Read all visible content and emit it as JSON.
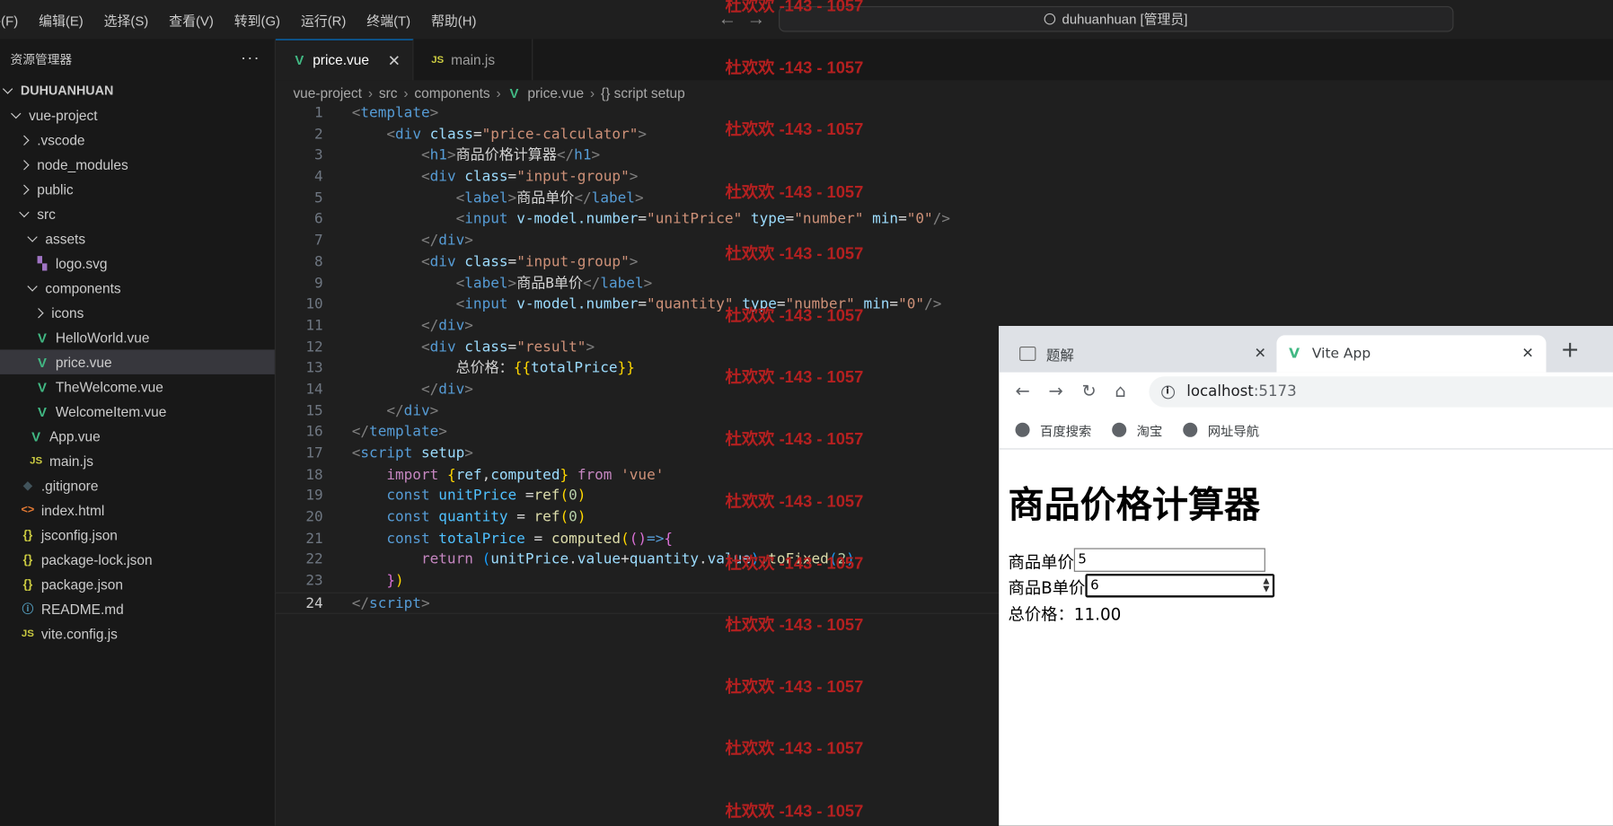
{
  "menu": [
    "件(F)",
    "编辑(E)",
    "选择(S)",
    "查看(V)",
    "转到(G)",
    "运行(R)",
    "终端(T)",
    "帮助(H)"
  ],
  "command_center": "duhuanhuan [管理员]",
  "sidebar": {
    "title": "资源管理器",
    "root": "DUHUANHUAN",
    "items": [
      {
        "label": "vue-project",
        "depth": 0,
        "chev": "down",
        "icon": ""
      },
      {
        "label": ".vscode",
        "depth": 1,
        "chev": "right",
        "icon": ""
      },
      {
        "label": "node_modules",
        "depth": 1,
        "chev": "right",
        "icon": ""
      },
      {
        "label": "public",
        "depth": 1,
        "chev": "right",
        "icon": ""
      },
      {
        "label": "src",
        "depth": 1,
        "chev": "down",
        "icon": ""
      },
      {
        "label": "assets",
        "depth": 2,
        "chev": "down",
        "icon": ""
      },
      {
        "label": "logo.svg",
        "depth": 3,
        "chev": "",
        "icon": "svg"
      },
      {
        "label": "components",
        "depth": 2,
        "chev": "down",
        "icon": ""
      },
      {
        "label": "icons",
        "depth": 3,
        "chev": "right",
        "icon": ""
      },
      {
        "label": "HelloWorld.vue",
        "depth": 3,
        "chev": "",
        "icon": "vue"
      },
      {
        "label": "price.vue",
        "depth": 3,
        "chev": "",
        "icon": "vue",
        "selected": true
      },
      {
        "label": "TheWelcome.vue",
        "depth": 3,
        "chev": "",
        "icon": "vue"
      },
      {
        "label": "WelcomeItem.vue",
        "depth": 3,
        "chev": "",
        "icon": "vue"
      },
      {
        "label": "App.vue",
        "depth": 2,
        "chev": "",
        "icon": "vue"
      },
      {
        "label": "main.js",
        "depth": 2,
        "chev": "",
        "icon": "js"
      },
      {
        "label": ".gitignore",
        "depth": 1,
        "chev": "",
        "icon": "git"
      },
      {
        "label": "index.html",
        "depth": 1,
        "chev": "",
        "icon": "html"
      },
      {
        "label": "jsconfig.json",
        "depth": 1,
        "chev": "",
        "icon": "json"
      },
      {
        "label": "package-lock.json",
        "depth": 1,
        "chev": "",
        "icon": "json"
      },
      {
        "label": "package.json",
        "depth": 1,
        "chev": "",
        "icon": "json"
      },
      {
        "label": "README.md",
        "depth": 1,
        "chev": "",
        "icon": "info"
      },
      {
        "label": "vite.config.js",
        "depth": 1,
        "chev": "",
        "icon": "js"
      }
    ]
  },
  "tabs": [
    {
      "label": "price.vue",
      "icon": "vue",
      "active": true
    },
    {
      "label": "main.js",
      "icon": "js",
      "active": false
    }
  ],
  "breadcrumb": [
    "vue-project",
    "src",
    "components",
    "price.vue",
    "{} script setup"
  ],
  "code_lines": [
    [
      [
        "t-br",
        "<"
      ],
      [
        "t-tag",
        "template"
      ],
      [
        "t-br",
        ">"
      ]
    ],
    [
      [
        "t-txt",
        "    "
      ],
      [
        "t-br",
        "<"
      ],
      [
        "t-tag",
        "div"
      ],
      [
        "t-txt",
        " "
      ],
      [
        "t-attr",
        "class"
      ],
      [
        "t-txt",
        "="
      ],
      [
        "t-str",
        "\"price-calculator\""
      ],
      [
        "t-br",
        ">"
      ]
    ],
    [
      [
        "t-txt",
        "        "
      ],
      [
        "t-br",
        "<"
      ],
      [
        "t-tag",
        "h1"
      ],
      [
        "t-br",
        ">"
      ],
      [
        "t-txt",
        "商品价格计算器"
      ],
      [
        "t-br",
        "</"
      ],
      [
        "t-tag",
        "h1"
      ],
      [
        "t-br",
        ">"
      ]
    ],
    [
      [
        "t-txt",
        "        "
      ],
      [
        "t-br",
        "<"
      ],
      [
        "t-tag",
        "div"
      ],
      [
        "t-txt",
        " "
      ],
      [
        "t-attr",
        "class"
      ],
      [
        "t-txt",
        "="
      ],
      [
        "t-str",
        "\"input-group\""
      ],
      [
        "t-br",
        ">"
      ]
    ],
    [
      [
        "t-txt",
        "            "
      ],
      [
        "t-br",
        "<"
      ],
      [
        "t-tag",
        "label"
      ],
      [
        "t-br",
        ">"
      ],
      [
        "t-txt",
        "商品单价"
      ],
      [
        "t-br",
        "</"
      ],
      [
        "t-tag",
        "label"
      ],
      [
        "t-br",
        ">"
      ]
    ],
    [
      [
        "t-txt",
        "            "
      ],
      [
        "t-br",
        "<"
      ],
      [
        "t-tag",
        "input"
      ],
      [
        "t-txt",
        " "
      ],
      [
        "t-attr",
        "v-model.number"
      ],
      [
        "t-txt",
        "="
      ],
      [
        "t-str",
        "\"unitPrice\""
      ],
      [
        "t-txt",
        " "
      ],
      [
        "t-attr",
        "type"
      ],
      [
        "t-txt",
        "="
      ],
      [
        "t-str",
        "\"number\""
      ],
      [
        "t-txt",
        " "
      ],
      [
        "t-attr",
        "min"
      ],
      [
        "t-txt",
        "="
      ],
      [
        "t-str",
        "\"0\""
      ],
      [
        "t-br",
        "/>"
      ]
    ],
    [
      [
        "t-txt",
        "        "
      ],
      [
        "t-br",
        "</"
      ],
      [
        "t-tag",
        "div"
      ],
      [
        "t-br",
        ">"
      ]
    ],
    [
      [
        "t-txt",
        "        "
      ],
      [
        "t-br",
        "<"
      ],
      [
        "t-tag",
        "div"
      ],
      [
        "t-txt",
        " "
      ],
      [
        "t-attr",
        "class"
      ],
      [
        "t-txt",
        "="
      ],
      [
        "t-str",
        "\"input-group\""
      ],
      [
        "t-br",
        ">"
      ]
    ],
    [
      [
        "t-txt",
        "            "
      ],
      [
        "t-br",
        "<"
      ],
      [
        "t-tag",
        "label"
      ],
      [
        "t-br",
        ">"
      ],
      [
        "t-txt",
        "商品B单价"
      ],
      [
        "t-br",
        "</"
      ],
      [
        "t-tag",
        "label"
      ],
      [
        "t-br",
        ">"
      ]
    ],
    [
      [
        "t-txt",
        "            "
      ],
      [
        "t-br",
        "<"
      ],
      [
        "t-tag",
        "input"
      ],
      [
        "t-txt",
        " "
      ],
      [
        "t-attr",
        "v-model.number"
      ],
      [
        "t-txt",
        "="
      ],
      [
        "t-str",
        "\"quantity\""
      ],
      [
        "t-txt",
        " "
      ],
      [
        "t-attr",
        "type"
      ],
      [
        "t-txt",
        "="
      ],
      [
        "t-str",
        "\"number\""
      ],
      [
        "t-txt",
        " "
      ],
      [
        "t-attr",
        "min"
      ],
      [
        "t-txt",
        "="
      ],
      [
        "t-str",
        "\"0\""
      ],
      [
        "t-br",
        "/>"
      ]
    ],
    [
      [
        "t-txt",
        "        "
      ],
      [
        "t-br",
        "</"
      ],
      [
        "t-tag",
        "div"
      ],
      [
        "t-br",
        ">"
      ]
    ],
    [
      [
        "t-txt",
        "        "
      ],
      [
        "t-br",
        "<"
      ],
      [
        "t-tag",
        "div"
      ],
      [
        "t-txt",
        " "
      ],
      [
        "t-attr",
        "class"
      ],
      [
        "t-txt",
        "="
      ],
      [
        "t-str",
        "\"result\""
      ],
      [
        "t-br",
        ">"
      ]
    ],
    [
      [
        "t-txt",
        "            总价格："
      ],
      [
        "t-p1",
        "{{"
      ],
      [
        "t-attr",
        "totalPrice"
      ],
      [
        "t-p1",
        "}}"
      ]
    ],
    [
      [
        "t-txt",
        "        "
      ],
      [
        "t-br",
        "</"
      ],
      [
        "t-tag",
        "div"
      ],
      [
        "t-br",
        ">"
      ]
    ],
    [
      [
        "t-txt",
        "    "
      ],
      [
        "t-br",
        "</"
      ],
      [
        "t-tag",
        "div"
      ],
      [
        "t-br",
        ">"
      ]
    ],
    [
      [
        "t-br",
        "</"
      ],
      [
        "t-tag",
        "template"
      ],
      [
        "t-br",
        ">"
      ]
    ],
    [
      [
        "t-br",
        "<"
      ],
      [
        "t-tag",
        "script"
      ],
      [
        "t-txt",
        " "
      ],
      [
        "t-attr",
        "setup"
      ],
      [
        "t-br",
        ">"
      ]
    ],
    [
      [
        "t-txt",
        "    "
      ],
      [
        "t-kw",
        "import"
      ],
      [
        "t-txt",
        " "
      ],
      [
        "t-p1",
        "{"
      ],
      [
        "t-attr",
        "ref"
      ],
      [
        "t-txt",
        ","
      ],
      [
        "t-attr",
        "computed"
      ],
      [
        "t-p1",
        "}"
      ],
      [
        "t-txt",
        " "
      ],
      [
        "t-kw",
        "from"
      ],
      [
        "t-txt",
        " "
      ],
      [
        "t-str",
        "'vue'"
      ]
    ],
    [
      [
        "t-txt",
        "    "
      ],
      [
        "t-dec",
        "const"
      ],
      [
        "t-txt",
        " "
      ],
      [
        "t-var",
        "unitPrice"
      ],
      [
        "t-txt",
        " ="
      ],
      [
        "t-fn",
        "ref"
      ],
      [
        "t-p1",
        "("
      ],
      [
        "t-num",
        "0"
      ],
      [
        "t-p1",
        ")"
      ]
    ],
    [
      [
        "t-txt",
        "    "
      ],
      [
        "t-dec",
        "const"
      ],
      [
        "t-txt",
        " "
      ],
      [
        "t-var",
        "quantity"
      ],
      [
        "t-txt",
        " = "
      ],
      [
        "t-fn",
        "ref"
      ],
      [
        "t-p1",
        "("
      ],
      [
        "t-num",
        "0"
      ],
      [
        "t-p1",
        ")"
      ]
    ],
    [
      [
        "t-txt",
        "    "
      ],
      [
        "t-dec",
        "const"
      ],
      [
        "t-txt",
        " "
      ],
      [
        "t-var",
        "totalPrice"
      ],
      [
        "t-txt",
        " = "
      ],
      [
        "t-fn",
        "computed"
      ],
      [
        "t-p1",
        "("
      ],
      [
        "t-p2",
        "()"
      ],
      [
        "t-dec",
        "=>"
      ],
      [
        "t-p2",
        "{"
      ]
    ],
    [
      [
        "t-txt",
        "        "
      ],
      [
        "t-kw",
        "return"
      ],
      [
        "t-txt",
        " "
      ],
      [
        "t-p3",
        "("
      ],
      [
        "t-attr",
        "unitPrice"
      ],
      [
        "t-txt",
        "."
      ],
      [
        "t-attr",
        "value"
      ],
      [
        "t-txt",
        "+"
      ],
      [
        "t-attr",
        "quantity"
      ],
      [
        "t-txt",
        "."
      ],
      [
        "t-attr",
        "value"
      ],
      [
        "t-p3",
        ")"
      ],
      [
        "t-txt",
        "."
      ],
      [
        "t-fn",
        "toFixed"
      ],
      [
        "t-p3",
        "("
      ],
      [
        "t-num",
        "2"
      ],
      [
        "t-p3",
        ")"
      ]
    ],
    [
      [
        "t-txt",
        "    "
      ],
      [
        "t-p2",
        "}"
      ],
      [
        "t-p1",
        ")"
      ]
    ],
    [
      [
        "t-br",
        "</"
      ],
      [
        "t-tag",
        "script"
      ],
      [
        "t-br",
        ">"
      ]
    ]
  ],
  "current_line": 24,
  "watermark": "杜欢欢 -143 - 1057",
  "watermark_colour": "#b52020",
  "browser": {
    "tabs": [
      {
        "label": "题解",
        "active": false
      },
      {
        "label": "Vite App",
        "active": true
      }
    ],
    "url_host": "localhost",
    "url_port": ":5173",
    "bookmarks": [
      "百度搜索",
      "淘宝",
      "网址导航"
    ],
    "page": {
      "heading": "商品价格计算器",
      "label1": "商品单价",
      "value1": "5",
      "label2": "商品B单价",
      "value2": "6",
      "result": "总价格：11.00"
    }
  }
}
